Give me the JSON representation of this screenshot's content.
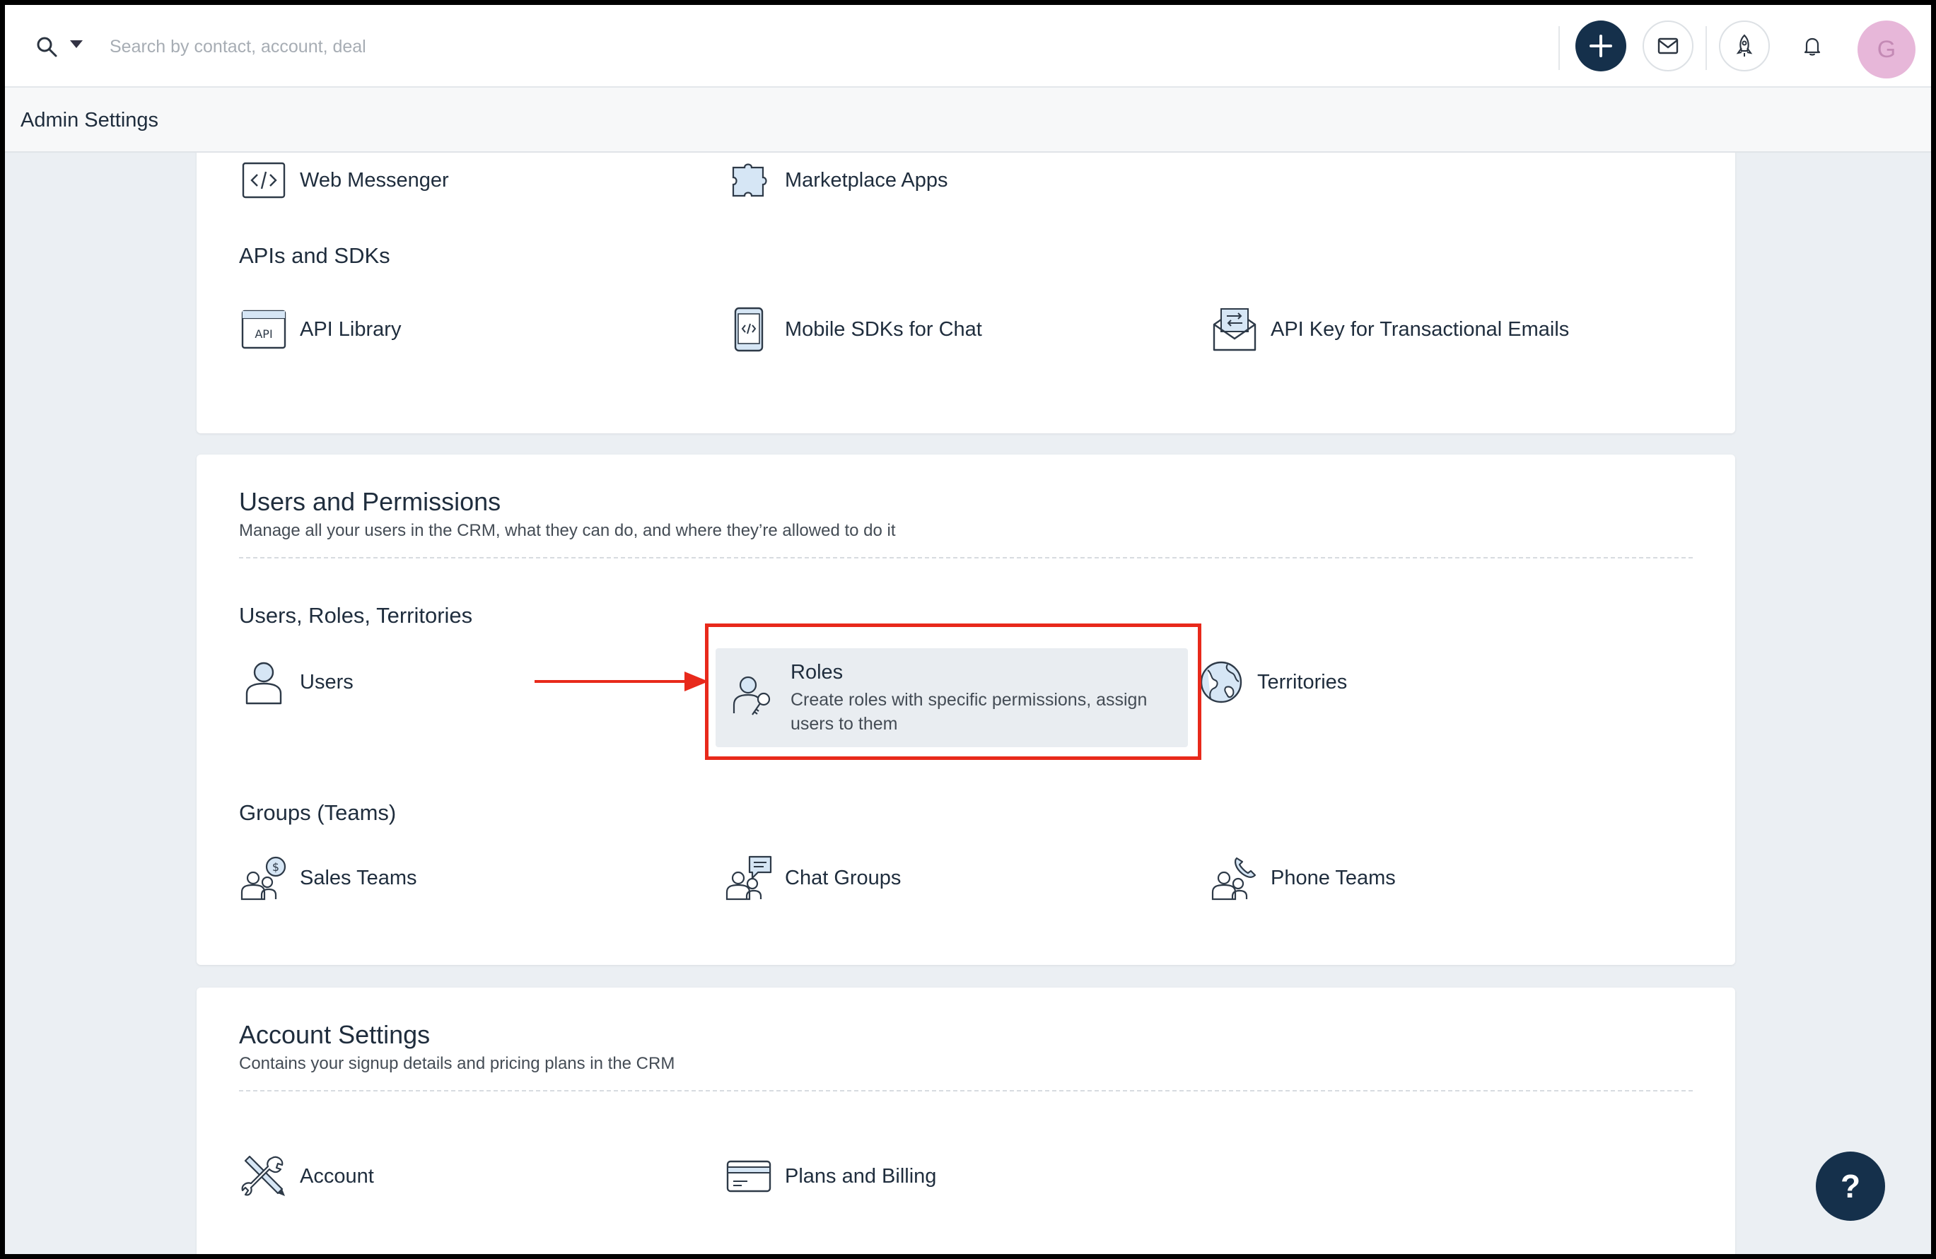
{
  "topbar": {
    "search_placeholder": "Search by contact, account, deal",
    "avatar_initial": "G"
  },
  "header": {
    "title": "Admin Settings"
  },
  "integrations_partial": {
    "items": [
      {
        "label": "Web Messenger",
        "icon": "code-window-icon"
      },
      {
        "label": "Marketplace Apps",
        "icon": "puzzle-icon"
      }
    ]
  },
  "apis_sdks": {
    "title": "APIs and SDKs",
    "items": [
      {
        "label": "API Library",
        "icon": "api-icon"
      },
      {
        "label": "Mobile SDKs for Chat",
        "icon": "mobile-code-icon"
      },
      {
        "label": "API Key for Transactional Emails",
        "icon": "email-key-icon"
      }
    ]
  },
  "users_permissions": {
    "title": "Users and Permissions",
    "description": "Manage all your users in the CRM, what they can do, and where they’re allowed to do it",
    "group1_title": "Users, Roles, Territories",
    "users_label": "Users",
    "roles_title": "Roles",
    "roles_description": "Create roles with specific permissions, assign users to them",
    "territories_label": "Territories",
    "group2_title": "Groups (Teams)",
    "teams": [
      {
        "label": "Sales Teams",
        "icon": "sales-team-icon"
      },
      {
        "label": "Chat Groups",
        "icon": "chat-group-icon"
      },
      {
        "label": "Phone Teams",
        "icon": "phone-team-icon"
      }
    ]
  },
  "account_settings": {
    "title": "Account Settings",
    "description": "Contains your signup details and pricing plans in the CRM",
    "items": [
      {
        "label": "Account",
        "icon": "tools-icon"
      },
      {
        "label": "Plans and Billing",
        "icon": "credit-card-icon"
      }
    ]
  },
  "help": {
    "label": "?"
  },
  "colors": {
    "accent_dark": "#15304b",
    "highlight_red": "#e8291b",
    "page_bg": "#ebeff3"
  }
}
